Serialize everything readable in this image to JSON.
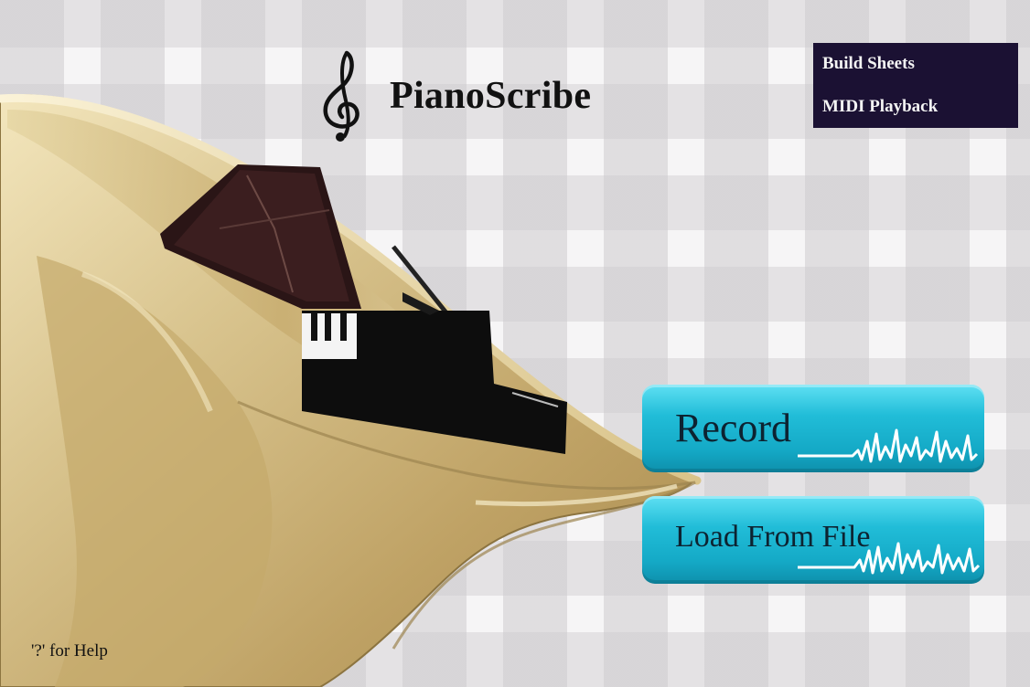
{
  "app": {
    "title": "PianoScribe"
  },
  "menu": {
    "items": [
      {
        "label": "Build Sheets"
      },
      {
        "label": "MIDI Playback"
      }
    ]
  },
  "buttons": {
    "record_label": "Record",
    "load_label": "Load From File"
  },
  "footer": {
    "help_text": "'?' for Help"
  },
  "icons": {
    "title_icon": "treble-clef-icon",
    "button_decoration": "waveform-icon",
    "illustration": "tuba-with-grand-piano"
  },
  "colors": {
    "menu_bg": "#1b1133",
    "button_cyan": "#21bdd8",
    "brass": "#c9b174"
  }
}
